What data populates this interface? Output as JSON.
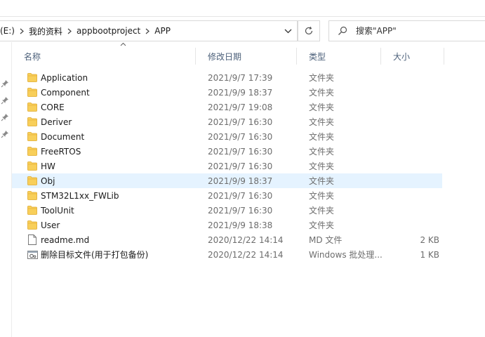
{
  "breadcrumb": {
    "items": [
      "(E:)",
      "我的资料",
      "appbootproject",
      "APP"
    ]
  },
  "search": {
    "placeholder": "搜索\"APP\""
  },
  "columns": {
    "name": "名称",
    "date": "修改日期",
    "type": "类型",
    "size": "大小"
  },
  "files": [
    {
      "name": "Application",
      "date": "2021/9/7 17:39",
      "type": "文件夹",
      "size": "",
      "kind": "folder-icon"
    },
    {
      "name": "Component",
      "date": "2021/9/9 18:37",
      "type": "文件夹",
      "size": "",
      "kind": "folder-icon"
    },
    {
      "name": "CORE",
      "date": "2021/9/7 19:08",
      "type": "文件夹",
      "size": "",
      "kind": "folder-icon"
    },
    {
      "name": "Deriver",
      "date": "2021/9/7 16:30",
      "type": "文件夹",
      "size": "",
      "kind": "folder-icon"
    },
    {
      "name": "Document",
      "date": "2021/9/7 16:30",
      "type": "文件夹",
      "size": "",
      "kind": "folder-icon"
    },
    {
      "name": "FreeRTOS",
      "date": "2021/9/7 16:30",
      "type": "文件夹",
      "size": "",
      "kind": "folder-icon"
    },
    {
      "name": "HW",
      "date": "2021/9/7 16:30",
      "type": "文件夹",
      "size": "",
      "kind": "folder-icon"
    },
    {
      "name": "Obj",
      "date": "2021/9/9 18:37",
      "type": "文件夹",
      "size": "",
      "kind": "folder-icon"
    },
    {
      "name": "STM32L1xx_FWLib",
      "date": "2021/9/7 16:30",
      "type": "文件夹",
      "size": "",
      "kind": "folder-icon"
    },
    {
      "name": "ToolUnit",
      "date": "2021/9/7 16:30",
      "type": "文件夹",
      "size": "",
      "kind": "folder-icon"
    },
    {
      "name": "User",
      "date": "2021/9/9 18:38",
      "type": "文件夹",
      "size": "",
      "kind": "folder-icon"
    },
    {
      "name": "readme.md",
      "date": "2020/12/22 14:14",
      "type": "MD 文件",
      "size": "2 KB",
      "kind": "document-icon"
    },
    {
      "name": "删除目标文件(用于打包备份)",
      "date": "2020/12/22 14:14",
      "type": "Windows 批处理...",
      "size": "1 KB",
      "kind": "batch-file-icon"
    }
  ],
  "selected_row": "Obj",
  "colors": {
    "folder": "#f8cf5a",
    "selection": "#e5f3ff",
    "header_text": "#4c607a"
  }
}
